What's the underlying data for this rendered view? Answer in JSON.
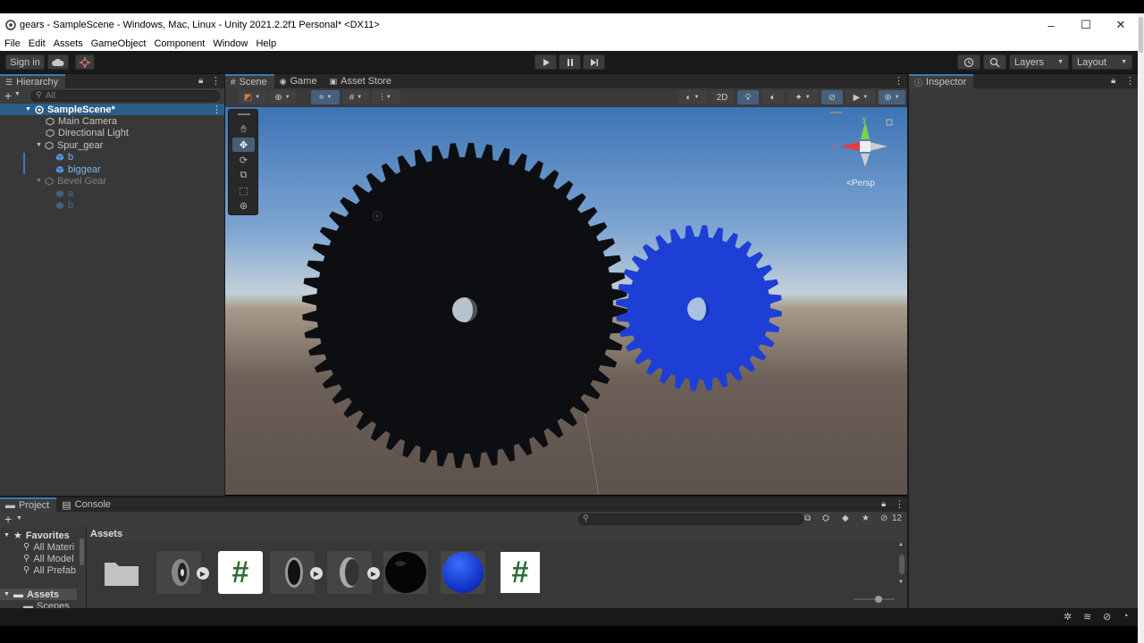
{
  "window": {
    "title": "gears - SampleScene - Windows, Mac, Linux - Unity 2021.2.2f1 Personal* <DX11>",
    "controls": [
      "–",
      "☐",
      "✕"
    ]
  },
  "menu": [
    "File",
    "Edit",
    "Assets",
    "GameObject",
    "Component",
    "Window",
    "Help"
  ],
  "toolbar": {
    "sign_in": "Sign in",
    "layers": "Layers",
    "layout": "Layout"
  },
  "hierarchy": {
    "tab": "Hierarchy",
    "search_placeholder": "All",
    "scene": "SampleScene*",
    "items": [
      {
        "label": "Main Camera",
        "indent": 1
      },
      {
        "label": "Directional Light",
        "indent": 1
      },
      {
        "label": "Spur_gear",
        "indent": 1
      },
      {
        "label": "b",
        "indent": 2
      },
      {
        "label": "biggear",
        "indent": 2
      },
      {
        "label": "Bevel Gear",
        "indent": 1
      },
      {
        "label": "a",
        "indent": 2
      },
      {
        "label": "b",
        "indent": 2
      }
    ]
  },
  "scene_tabs": [
    "Scene",
    "Game",
    "Asset Store"
  ],
  "scene_toolbar": {
    "mode_2d": "2D"
  },
  "gizmo": {
    "y": "y",
    "x": "x",
    "persp": "<Persp"
  },
  "inspector": {
    "tab": "Inspector"
  },
  "project": {
    "tabs": [
      "Project",
      "Console"
    ],
    "favorites_label": "Favorites",
    "favorites": [
      "All Materi",
      "All Model",
      "All Prefab"
    ],
    "assets_label": "Assets",
    "folders": [
      "Scenes"
    ],
    "breadcrumb": "Assets",
    "hidden_count": "12",
    "script_glyph": "#"
  },
  "colors": {
    "accent": "#3a79bb",
    "gear_big": "#0d0e12",
    "gear_small": "#1e3fd6",
    "panel": "#383838",
    "toolbar": "#191919"
  },
  "icons": [
    "unity-icon",
    "cloud-icon",
    "collab-icon",
    "play-icon",
    "pause-icon",
    "step-icon",
    "history-icon",
    "search-icon",
    "lock-icon",
    "menu-icon",
    "hand-icon",
    "move-icon",
    "rotate-icon",
    "scale-icon",
    "rect-icon",
    "transform-icon",
    "light-icon",
    "audio-icon",
    "effects-icon",
    "visibility-icon",
    "camera-icon",
    "gizmos-icon",
    "folder-icon",
    "star-icon"
  ]
}
